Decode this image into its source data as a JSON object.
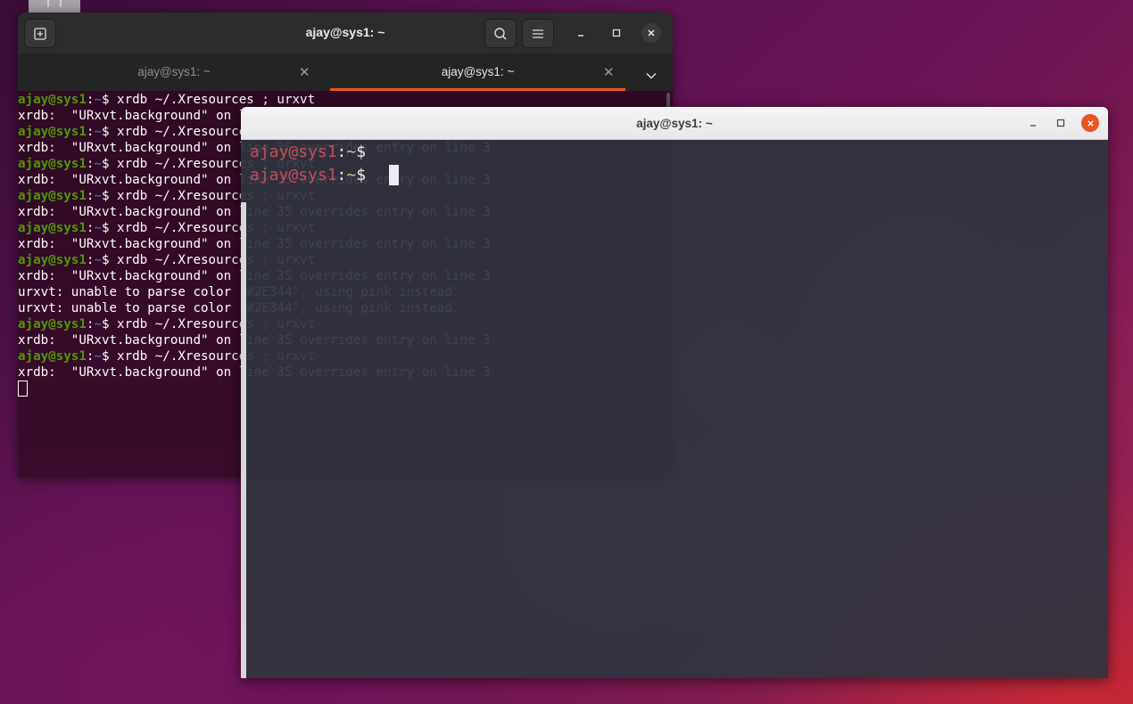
{
  "desktop": {},
  "gnome_terminal": {
    "title": "ajay@sys1: ~",
    "tabs": [
      {
        "label": "ajay@sys1: ~",
        "active": false
      },
      {
        "label": "ajay@sys1: ~",
        "active": true
      }
    ],
    "accent_color": "#e95420",
    "lines": [
      {
        "user": "ajay@sys1",
        "sep": ":",
        "path": "~",
        "cmd": "$ xrdb ~/.Xresources ; urxvt"
      },
      {
        "text": "xrdb:  \"URxvt.background\" on line 35 overrides entry on line 3"
      },
      {
        "user": "ajay@sys1",
        "sep": ":",
        "path": "~",
        "cmd": "$ xrdb ~/.Xresources ; urxvt"
      },
      {
        "text": "xrdb:  \"URxvt.background\" on line 35 overrides entry on line 3"
      },
      {
        "user": "ajay@sys1",
        "sep": ":",
        "path": "~",
        "cmd": "$ xrdb ~/.Xresources ; urxvt"
      },
      {
        "text": "xrdb:  \"URxvt.background\" on line 35 overrides entry on line 3"
      },
      {
        "user": "ajay@sys1",
        "sep": ":",
        "path": "~",
        "cmd": "$ xrdb ~/.Xresources ; urxvt"
      },
      {
        "text": "xrdb:  \"URxvt.background\" on line 35 overrides entry on line 3"
      },
      {
        "user": "ajay@sys1",
        "sep": ":",
        "path": "~",
        "cmd": "$ xrdb ~/.Xresources ; urxvt"
      },
      {
        "text": "xrdb:  \"URxvt.background\" on line 35 overrides entry on line 3"
      },
      {
        "user": "ajay@sys1",
        "sep": ":",
        "path": "~",
        "cmd": "$ xrdb ~/.Xresources ; urxvt"
      },
      {
        "text": "xrdb:  \"URxvt.background\" on line 35 overrides entry on line 3"
      },
      {
        "text": "urxvt: unable to parse color '#2E344', using pink instead."
      },
      {
        "text": "urxvt: unable to parse color '#2E344', using pink instead."
      },
      {
        "user": "ajay@sys1",
        "sep": ":",
        "path": "~",
        "cmd": "$ xrdb ~/.Xresources ; urxvt"
      },
      {
        "text": "xrdb:  \"URxvt.background\" on line 35 overrides entry on line 3"
      },
      {
        "user": "ajay@sys1",
        "sep": ":",
        "path": "~",
        "cmd": "$ xrdb ~/.Xresources ; urxvt"
      },
      {
        "text": "xrdb:  \"URxvt.background\" on line 35 overrides entry on line 3"
      }
    ]
  },
  "urxvt": {
    "title": "ajay@sys1: ~",
    "lines": [
      {
        "user": "ajay@sys1",
        "sep": ":",
        "path": "~",
        "prompt": "$ "
      },
      {
        "user": "ajay@sys1",
        "sep": ":",
        "path": "~",
        "prompt": "$ "
      }
    ]
  }
}
